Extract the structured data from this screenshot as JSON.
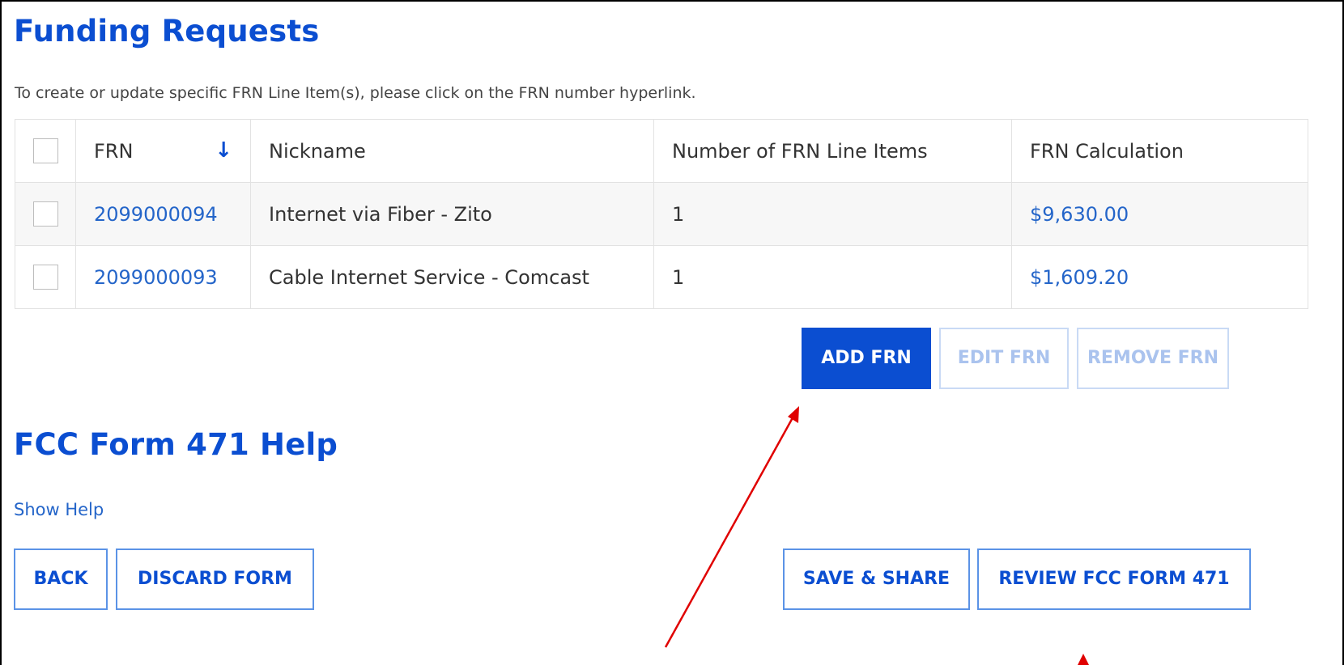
{
  "funding_requests": {
    "title": "Funding Requests",
    "instructions": "To create or update specific FRN Line Item(s), please click on the FRN number hyperlink.",
    "table": {
      "columns": [
        "FRN",
        "Nickname",
        "Number of FRN Line Items",
        "FRN Calculation"
      ],
      "sort_icon": "arrow-down-icon",
      "rows": [
        {
          "frn": "2099000094",
          "nickname": "Internet via Fiber - Zito",
          "line_items": "1",
          "calculation": "$9,630.00"
        },
        {
          "frn": "2099000093",
          "nickname": "Cable Internet Service - Comcast",
          "line_items": "1",
          "calculation": "$1,609.20"
        }
      ]
    },
    "buttons": {
      "add": "ADD FRN",
      "edit": "EDIT FRN",
      "remove": "REMOVE FRN"
    }
  },
  "help": {
    "title": "FCC Form 471 Help",
    "show_help": "Show Help"
  },
  "footer": {
    "back": "BACK",
    "discard": "DISCARD FORM",
    "save_share": "SAVE & SHARE",
    "review": "REVIEW FCC FORM 471"
  },
  "colors": {
    "heading": "#0b4ed1",
    "link": "#2465c9",
    "primary_button": "#0b4ed1",
    "annotation_arrow": "#e00000"
  }
}
